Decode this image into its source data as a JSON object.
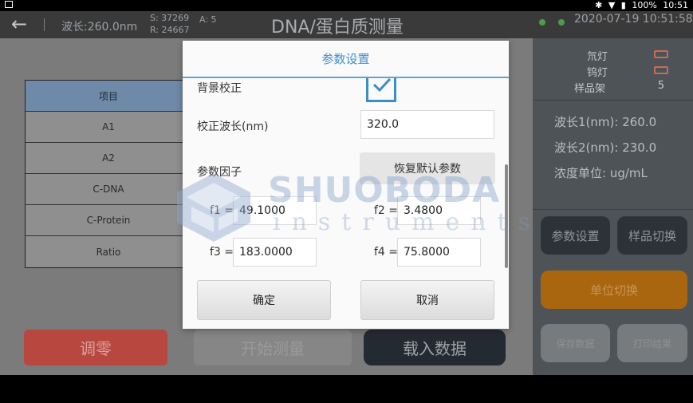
{
  "status_bar": {
    "battery": "100%",
    "time": "10:51"
  },
  "header": {
    "back_icon": "back-arrow-icon",
    "wavelength": "波长:260.0nm",
    "s_value": "S: 37269",
    "r_value": "R: 24667",
    "a_value": "A: 5",
    "title": "DNA/蛋白质测量",
    "datetime": "2020-07-19 10:51:58"
  },
  "table": {
    "header": "项目",
    "rows": [
      "A1",
      "A2",
      "C-DNA",
      "C-Protein",
      "Ratio"
    ]
  },
  "bottom_buttons": {
    "zero": "调零",
    "start": "开始测量",
    "load": "载入数据"
  },
  "right_panel": {
    "lamps": [
      {
        "label": "氘灯",
        "icon": "lamp-status-icon"
      },
      {
        "label": "钨灯",
        "icon": "lamp-status-icon"
      }
    ],
    "sample_holder_label": "样品架",
    "sample_holder_value": "5",
    "info": {
      "wavelength1": "波长1(nm): 260.0",
      "wavelength2": "波长2(nm): 230.0",
      "conc_unit": "浓度单位: ug/mL"
    },
    "buttons": {
      "params": "参数设置",
      "sample_switch": "样品切换",
      "unit_switch": "单位切换",
      "save": "保存数据",
      "print": "打印结果"
    },
    "colors": {
      "unit_switch": "#a9660f"
    }
  },
  "dialog": {
    "title": "参数设置",
    "background_correction_label": "背景校正",
    "background_correction_checked": true,
    "correction_wavelength_label": "校正波长(nm)",
    "correction_wavelength_value": "320.0",
    "factors_label": "参数因子",
    "restore_button": "恢复默认参数",
    "f1_label": "f1 =",
    "f1_value": "49.1000",
    "f2_label": "f2 =",
    "f2_value": "3.4800",
    "f3_label": "f3 =",
    "f3_value": "183.0000",
    "f4_label": "f4 =",
    "f4_value": "75.8000",
    "ok_button": "确定",
    "cancel_button": "取消",
    "accent_color": "#3f8fc9"
  },
  "watermark": {
    "name": "SHUOBODA",
    "sub": "instruments"
  }
}
